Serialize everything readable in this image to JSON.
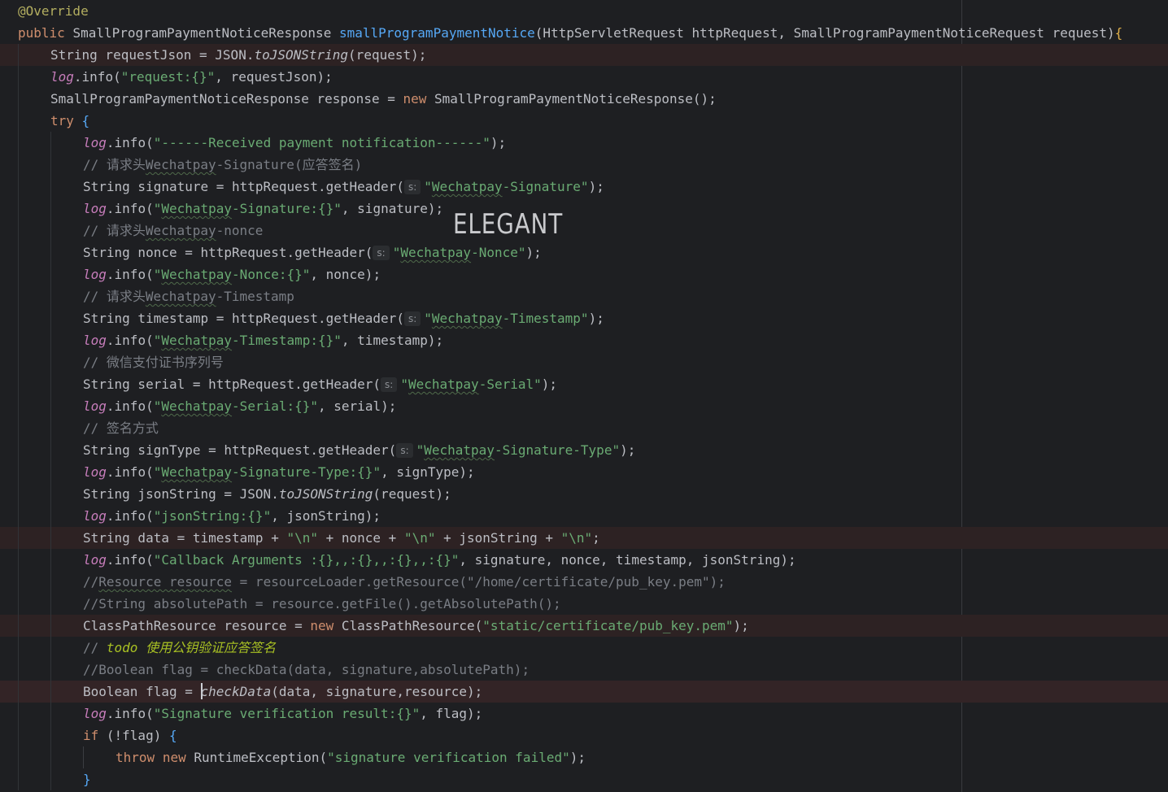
{
  "editor": {
    "watermark_text": "ELEGANT",
    "line1_annotation": "@Override",
    "line2": {
      "kw_public": "public",
      "return_type": "SmallProgramPaymentNoticeResponse",
      "method_name": "smallProgramPaymentNotice",
      "params": "(HttpServletRequest httpRequest, SmallProgramPaymentNoticeRequest request)",
      "open_brace": "{"
    },
    "line3": {
      "pre": "String requestJson = JSON.",
      "static_call": "toJSONString",
      "post": "(request);"
    },
    "line4": {
      "field": "log",
      "mid": ".info(",
      "str": "\"request:{}\"",
      "post": ", requestJson);"
    },
    "line5": {
      "pre": "SmallProgramPaymentNoticeResponse response = ",
      "kw_new": "new",
      "post": " SmallProgramPaymentNoticeResponse();"
    },
    "line6": {
      "kw_try": "try",
      "open_brace": "{"
    },
    "line7": {
      "field": "log",
      "mid": ".info(",
      "str": "\"------Received payment notification------\"",
      "post": ");"
    },
    "line8": {
      "cmt_pre": "// 请求头",
      "cmt_typo": "Wechatpay",
      "cmt_post": "-Signature(应答签名)"
    },
    "line9": {
      "pre": "String signature = httpRequest.getHeader(",
      "hint": "s:",
      "str_q": "\"",
      "str_typo": "Wechatpay",
      "str_post": "-Signature\"",
      "post": ");"
    },
    "line10": {
      "field": "log",
      "mid": ".info(",
      "str_q": "\"",
      "str_typo": "Wechatpay",
      "str_post": "-Signature:{}\"",
      "post": ", signature);"
    },
    "line11": {
      "cmt_pre": "// 请求头",
      "cmt_typo": "Wechatpay",
      "cmt_post": "-nonce"
    },
    "line12": {
      "pre": "String nonce = httpRequest.getHeader(",
      "hint": "s:",
      "str_q": "\"",
      "str_typo": "Wechatpay",
      "str_post": "-Nonce\"",
      "post": ");"
    },
    "line13": {
      "field": "log",
      "mid": ".info(",
      "str_q": "\"",
      "str_typo": "Wechatpay",
      "str_post": "-Nonce:{}\"",
      "post": ", nonce);"
    },
    "line14": {
      "cmt_pre": "// 请求头",
      "cmt_typo": "Wechatpay",
      "cmt_post": "-Timestamp"
    },
    "line15": {
      "pre": "String timestamp = httpRequest.getHeader(",
      "hint": "s:",
      "str_q": "\"",
      "str_typo": "Wechatpay",
      "str_post": "-Timestamp\"",
      "post": ");"
    },
    "line16": {
      "field": "log",
      "mid": ".info(",
      "str_q": "\"",
      "str_typo": "Wechatpay",
      "str_post": "-Timestamp:{}\"",
      "post": ", timestamp);"
    },
    "line17": {
      "cmt": "// 微信支付证书序列号"
    },
    "line18": {
      "pre": "String serial = httpRequest.getHeader(",
      "hint": "s:",
      "str_q": "\"",
      "str_typo": "Wechatpay",
      "str_post": "-Serial\"",
      "post": ");"
    },
    "line19": {
      "field": "log",
      "mid": ".info(",
      "str_q": "\"",
      "str_typo": "Wechatpay",
      "str_post": "-Serial:{}\"",
      "post": ", serial);"
    },
    "line20": {
      "cmt": "// 签名方式"
    },
    "line21": {
      "pre": "String signType = httpRequest.getHeader(",
      "hint": "s:",
      "str_q": "\"",
      "str_typo": "Wechatpay",
      "str_post": "-Signature-Type\"",
      "post": ");"
    },
    "line22": {
      "field": "log",
      "mid": ".info(",
      "str_q": "\"",
      "str_typo": "Wechatpay",
      "str_post": "-Signature-Type:{}\"",
      "post": ", signType);"
    },
    "line23": {
      "pre": "String jsonString = JSON.",
      "static_call": "toJSONString",
      "post": "(request);"
    },
    "line24": {
      "field": "log",
      "mid": ".info(",
      "str": "\"jsonString:{}\"",
      "post": ", jsonString);"
    },
    "line25": {
      "pre": "String data = timestamp + ",
      "s1": "\"\\n\"",
      "m1": " + nonce + ",
      "s2": "\"\\n\"",
      "m2": " + jsonString + ",
      "s3": "\"\\n\"",
      "post": ";"
    },
    "line26": {
      "field": "log",
      "mid": ".info(",
      "str": "\"Callback Arguments :{},,:{},,:{},,:{}\"",
      "post": ", signature, nonce, timestamp, jsonString);"
    },
    "line27": {
      "cmt_pre": "//",
      "cmt_typo": "Resource resource",
      "cmt_post": " = resourceLoader.getResource(\"/home/certificate/pub_key.pem\");"
    },
    "line28": {
      "cmt": "//String absolutePath = resource.getFile().getAbsolutePath();"
    },
    "line29": {
      "pre": "ClassPathResource resource = ",
      "kw_new": "new",
      "mid": " ClassPathResource(",
      "str": "\"static/certificate/pub_key.pem\"",
      "post": ");"
    },
    "line30": {
      "cmt_pre": "// ",
      "todo": "todo 使用公钥验证应答签名"
    },
    "line31": {
      "cmt": "//Boolean flag = checkData(data, signature,absolutePath);"
    },
    "line32": {
      "pre": "Boolean flag = ",
      "static_call": "checkData",
      "post": "(data, signature,resource);"
    },
    "line33": {
      "field": "log",
      "mid": ".info(",
      "str": "\"Signature verification result:{}\"",
      "post": ", flag);"
    },
    "line34": {
      "kw_if": "if",
      "mid": " (!flag) ",
      "open_brace": "{"
    },
    "line35": {
      "kw_throw": "throw",
      "sp": " ",
      "kw_new": "new",
      "mid": " RuntimeException(",
      "str": "\"signature verification failed\"",
      "post": ");"
    },
    "line36": {
      "close_brace": "}"
    }
  }
}
